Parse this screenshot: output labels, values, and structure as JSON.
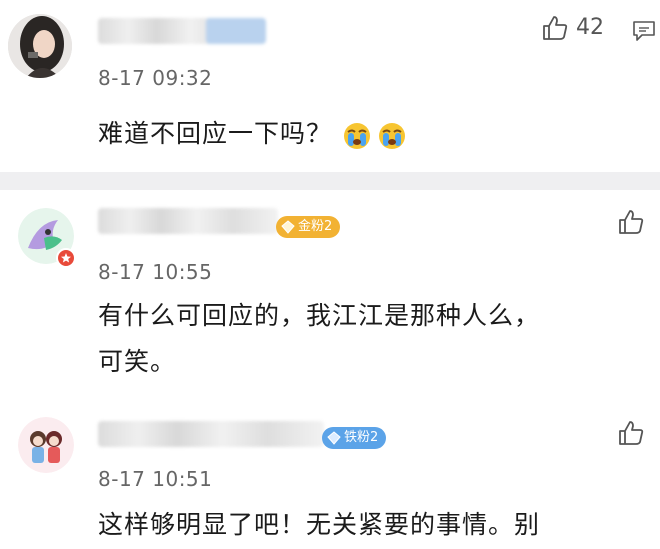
{
  "comments": [
    {
      "time": "8-17 09:32",
      "text": "难道不回应一下吗？",
      "emojis": [
        "crying-emoji",
        "crying-emoji"
      ],
      "likes": "42"
    },
    {
      "time": "8-17 10:55",
      "badge": "金粉2",
      "text_line1": "有什么可回应的，我江江是那种人么，",
      "text_line2": "可笑。"
    },
    {
      "time": "8-17 10:51",
      "badge": "铁粉2",
      "text": "这样够明显了吧！无关紧要的事情。别"
    }
  ],
  "colors": {
    "gold_badge": "#f2b233",
    "iron_badge": "#5ba3e8",
    "separator": "#efeff1"
  }
}
